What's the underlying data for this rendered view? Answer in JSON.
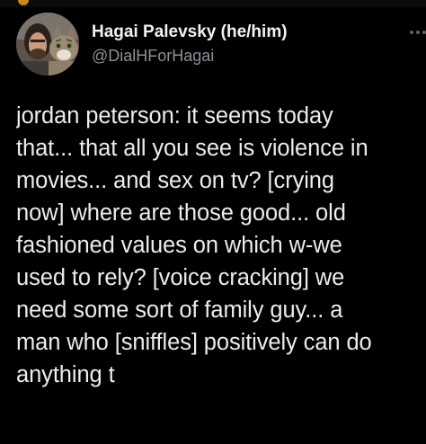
{
  "tweet": {
    "display_name": "Hagai Palevsky (he/him)",
    "handle": "@DialHForHagai",
    "text_lines": [
      "jordan peterson: it seems today",
      "that... that all you see is violence in",
      "movies... and sex on tv? [crying",
      "now] where are those good... old",
      "fashioned values on which w-we",
      "used to rely? [voice cracking] we",
      "need some sort of family guy... a",
      "man who [sniffles] positively can do",
      "anything t"
    ]
  },
  "icons": {
    "avatar": "profile-photo-man-with-cat",
    "more": "more-options-icon"
  },
  "colors": {
    "background": "#000000",
    "text": "#ececec",
    "handle": "#8b9196"
  }
}
